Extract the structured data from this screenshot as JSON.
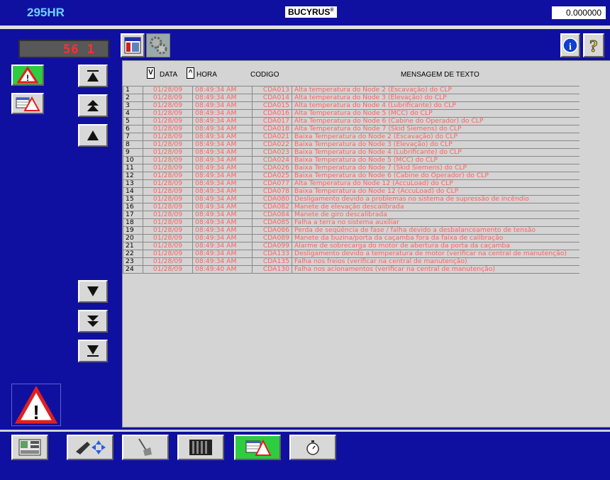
{
  "header": {
    "model": "295HR",
    "brand": "BUCYRUS",
    "brand_mark": "®",
    "value": "0.000000"
  },
  "left": {
    "display": "56 1"
  },
  "table": {
    "columns": {
      "date": "DATA",
      "time": "HORA",
      "code": "CODIGO",
      "message": "MENSAGEM DE TEXTO",
      "sort_date": "V",
      "sort_time": "^"
    },
    "rows": [
      {
        "n": "1",
        "d": "01/28/09",
        "t": "08:49:34 AM",
        "c": "CDA013",
        "m": "Alta temperatura do Node 2 (Escavação) do CLP"
      },
      {
        "n": "2",
        "d": "01/28/09",
        "t": "08:49:34 AM",
        "c": "CDA014",
        "m": "Alta temperatura do Node 3 (Elevação) do CLP"
      },
      {
        "n": "3",
        "d": "01/28/09",
        "t": "08:49:34 AM",
        "c": "CDA015",
        "m": "Alta temperatura do Node 4 (Lubrificante) do CLP"
      },
      {
        "n": "4",
        "d": "01/28/09",
        "t": "08:49:34 AM",
        "c": "CDA016",
        "m": "Alta Temperatura do Node 5 (MCC) do CLP"
      },
      {
        "n": "5",
        "d": "01/28/09",
        "t": "08:49:34 AM",
        "c": "CDA017",
        "m": "Alta Temperatura do Node 6 (Cabine do Operador) do CLP"
      },
      {
        "n": "6",
        "d": "01/28/09",
        "t": "08:49:34 AM",
        "c": "CDA018",
        "m": "Alta Temperatura do Node 7 (Skid Siemens) do CLP"
      },
      {
        "n": "7",
        "d": "01/28/09",
        "t": "08:49:34 AM",
        "c": "CDA021",
        "m": "Baixa Temperatura do Node 2 (Escavação) do CLP"
      },
      {
        "n": "8",
        "d": "01/28/09",
        "t": "08:49:34 AM",
        "c": "CDA022",
        "m": "Baixa Temperatura do Node 3 (Elevação) do CLP"
      },
      {
        "n": "9",
        "d": "01/28/09",
        "t": "08:49:34 AM",
        "c": "CDA023",
        "m": "Baixa Temperatura do Node 4 (Lubrificante) do CLP"
      },
      {
        "n": "10",
        "d": "01/28/09",
        "t": "08:49:34 AM",
        "c": "CDA024",
        "m": "Baixa Temperatura do Node 5 (MCC) do CLP"
      },
      {
        "n": "11",
        "d": "01/28/09",
        "t": "08:49:34 AM",
        "c": "CDA026",
        "m": "Baixa Temperatura do Node 7 (Skid Siemens) do CLP"
      },
      {
        "n": "12",
        "d": "01/28/09",
        "t": "08:49:34 AM",
        "c": "CDA025",
        "m": "Baixa Temperatura do Node 6 (Cabine do Operador) do CLP"
      },
      {
        "n": "13",
        "d": "01/28/09",
        "t": "08:49:34 AM",
        "c": "CDA077",
        "m": "Alta Temperatura do Node 12 (AccuLoad) do CLP"
      },
      {
        "n": "14",
        "d": "01/28/09",
        "t": "08:49:34 AM",
        "c": "CDA078",
        "m": "Baixa Temperatura do Node 12 (AccuLoad) do CLP"
      },
      {
        "n": "15",
        "d": "01/28/09",
        "t": "08:49:34 AM",
        "c": "CDA080",
        "m": "Desligamento devido a problemas no sistema de supressão de incêndio"
      },
      {
        "n": "16",
        "d": "01/28/09",
        "t": "08:49:34 AM",
        "c": "CDA082",
        "m": "Manete de elevação descalibrada"
      },
      {
        "n": "17",
        "d": "01/28/09",
        "t": "08:49:34 AM",
        "c": "CDA084",
        "m": "Manete de giro descalibrada"
      },
      {
        "n": "18",
        "d": "01/28/09",
        "t": "08:49:34 AM",
        "c": "CDA085",
        "m": "Falha a terra no sistema auxiliar"
      },
      {
        "n": "19",
        "d": "01/28/09",
        "t": "08:49:34 AM",
        "c": "CDA086",
        "m": "Perda de seqüência de fase / falha devido a desbalanceamento de tensão"
      },
      {
        "n": "20",
        "d": "01/28/09",
        "t": "08:49:34 AM",
        "c": "CDA089",
        "m": "Manete da buzina/porta da caçamba fora da faixa de calibração"
      },
      {
        "n": "21",
        "d": "01/28/09",
        "t": "08:49:34 AM",
        "c": "CDA099",
        "m": "Alarme de sobrecarga do motor de abertura da porta da caçamba"
      },
      {
        "n": "22",
        "d": "01/28/09",
        "t": "08:49:34 AM",
        "c": "CDA133",
        "m": "Desligamento devido a temperatura de motor (verificar na central de manutenção)"
      },
      {
        "n": "23",
        "d": "01/28/09",
        "t": "08:49:34 AM",
        "c": "CDA135",
        "m": "Falha nos freios (verificar na central de manutenção)"
      },
      {
        "n": "24",
        "d": "01/28/09",
        "t": "08:49:40 AM",
        "c": "CDA130",
        "m": "Falha nos acionamentos (verificar na central de manutenção)"
      }
    ]
  },
  "icons": {
    "info": "info-icon",
    "help": "help-icon",
    "alarm_active": "alarm-warning-icon",
    "alarm_list": "alarm-list-icon",
    "scroll_top": "scroll-top-icon",
    "page_up": "page-up-icon",
    "line_up": "line-up-icon",
    "line_down": "line-down-icon",
    "page_down": "page-down-icon",
    "scroll_bottom": "scroll-bottom-icon"
  }
}
